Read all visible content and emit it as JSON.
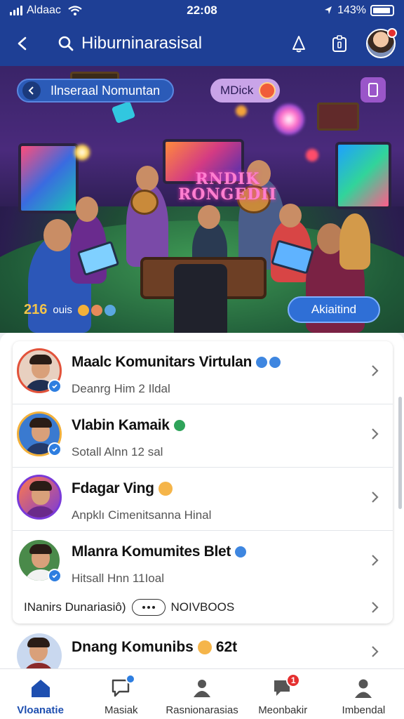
{
  "status_bar": {
    "carrier": "Aldaac",
    "time": "22:08",
    "battery": "143%"
  },
  "app_bar": {
    "title": "Hiburninarasisal"
  },
  "hero": {
    "community_chip": "Ilnseraal Nomuntan",
    "badge_label": "MDick",
    "sign_text": [
      "RNDIK",
      "RONGEDII"
    ],
    "member_count": "216",
    "member_label": "ouis",
    "cta_label": "Akiaitind"
  },
  "list": {
    "items": [
      {
        "title": "Maalc Komunitars Virtulan",
        "subtitle": "Deanrg Him 2 Ildal",
        "verified": true,
        "title_icons": [
          "blue",
          "blue"
        ]
      },
      {
        "title": "Vlabin Kamaik",
        "subtitle": "Sotall Alnn 12 sal",
        "verified": true,
        "title_icons": [
          "green"
        ]
      },
      {
        "title": "Fdagar Ving",
        "subtitle": "Anpklı Cimenitsanna Hinal",
        "verified": false,
        "title_icons": [
          "emoji"
        ]
      },
      {
        "title": "Mlanra Komumites Blet",
        "subtitle": "Hitsall Hnn 11Ioal",
        "verified": true,
        "title_icons": [
          "blue"
        ]
      }
    ],
    "inline_strip": {
      "left": "INanirs Dunariasiô)",
      "right": "NOIVBOOS"
    },
    "partial_item": {
      "title": "Dnang Komunibs",
      "count": "62t"
    }
  },
  "bottom_nav": {
    "items": [
      {
        "label": "Vloanatie",
        "icon": "home-icon",
        "active": true
      },
      {
        "label": "Masiak",
        "icon": "chat-icon",
        "active": false
      },
      {
        "label": "Rasnionarasias",
        "icon": "community-icon",
        "active": false
      },
      {
        "label": "Meonbakir",
        "icon": "notifications-icon",
        "active": false,
        "badge": "1"
      },
      {
        "label": "Imbendal",
        "icon": "profile-icon",
        "active": false
      }
    ]
  },
  "colors": {
    "primary": "#1e3f95",
    "accent": "#2f6fd6",
    "verified": "#2e7ee0",
    "alert": "#e53030"
  }
}
